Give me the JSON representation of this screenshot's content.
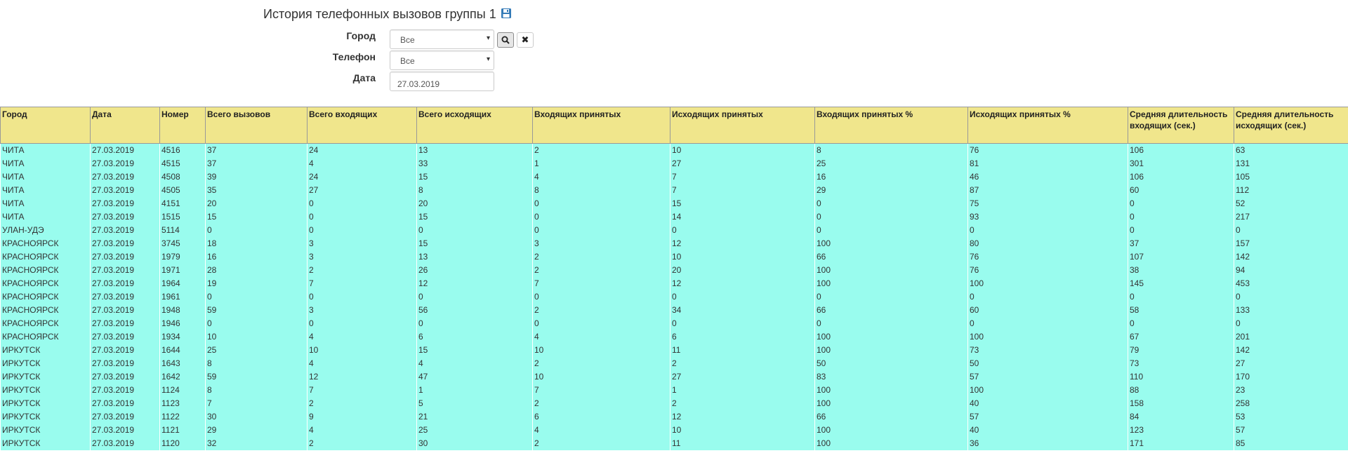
{
  "header": {
    "title": "История телефонных вызовов группы 1",
    "save_icon": "floppy-disk-icon",
    "accent_color": "#337ab7"
  },
  "filters": {
    "city_label": "Город",
    "city_value": "Все",
    "phone_label": "Телефон",
    "phone_value": "Все",
    "date_label": "Дата",
    "date_value": "27.03.2019",
    "search_icon": "search-icon",
    "clear_icon": "close-icon"
  },
  "table": {
    "header_color": "#f0e68c",
    "row_color": "#99fcee",
    "columns": [
      "Город",
      "Дата",
      "Номер",
      "Всего вызовов",
      "Всего входящих",
      "Всего исходящих",
      "Входящих принятых",
      "Исходящих принятых",
      "Входящих принятых %",
      "Исходящих принятых %",
      "Средняя длительность входящих (сек.)",
      "Средняя длительность исходящих (сек.)"
    ],
    "rows": [
      [
        "ЧИТА",
        "27.03.2019",
        "4516",
        "37",
        "24",
        "13",
        "2",
        "10",
        "8",
        "76",
        "106",
        "63"
      ],
      [
        "ЧИТА",
        "27.03.2019",
        "4515",
        "37",
        "4",
        "33",
        "1",
        "27",
        "25",
        "81",
        "301",
        "131"
      ],
      [
        "ЧИТА",
        "27.03.2019",
        "4508",
        "39",
        "24",
        "15",
        "4",
        "7",
        "16",
        "46",
        "106",
        "105"
      ],
      [
        "ЧИТА",
        "27.03.2019",
        "4505",
        "35",
        "27",
        "8",
        "8",
        "7",
        "29",
        "87",
        "60",
        "112"
      ],
      [
        "ЧИТА",
        "27.03.2019",
        "4151",
        "20",
        "0",
        "20",
        "0",
        "15",
        "0",
        "75",
        "0",
        "52"
      ],
      [
        "ЧИТА",
        "27.03.2019",
        "1515",
        "15",
        "0",
        "15",
        "0",
        "14",
        "0",
        "93",
        "0",
        "217"
      ],
      [
        "УЛАН-УДЭ",
        "27.03.2019",
        "5114",
        "0",
        "0",
        "0",
        "0",
        "0",
        "0",
        "0",
        "0",
        "0"
      ],
      [
        "КРАСНОЯРСК",
        "27.03.2019",
        "3745",
        "18",
        "3",
        "15",
        "3",
        "12",
        "100",
        "80",
        "37",
        "157"
      ],
      [
        "КРАСНОЯРСК",
        "27.03.2019",
        "1979",
        "16",
        "3",
        "13",
        "2",
        "10",
        "66",
        "76",
        "107",
        "142"
      ],
      [
        "КРАСНОЯРСК",
        "27.03.2019",
        "1971",
        "28",
        "2",
        "26",
        "2",
        "20",
        "100",
        "76",
        "38",
        "94"
      ],
      [
        "КРАСНОЯРСК",
        "27.03.2019",
        "1964",
        "19",
        "7",
        "12",
        "7",
        "12",
        "100",
        "100",
        "145",
        "453"
      ],
      [
        "КРАСНОЯРСК",
        "27.03.2019",
        "1961",
        "0",
        "0",
        "0",
        "0",
        "0",
        "0",
        "0",
        "0",
        "0"
      ],
      [
        "КРАСНОЯРСК",
        "27.03.2019",
        "1948",
        "59",
        "3",
        "56",
        "2",
        "34",
        "66",
        "60",
        "58",
        "133"
      ],
      [
        "КРАСНОЯРСК",
        "27.03.2019",
        "1946",
        "0",
        "0",
        "0",
        "0",
        "0",
        "0",
        "0",
        "0",
        "0"
      ],
      [
        "КРАСНОЯРСК",
        "27.03.2019",
        "1934",
        "10",
        "4",
        "6",
        "4",
        "6",
        "100",
        "100",
        "67",
        "201"
      ],
      [
        "ИРКУТСК",
        "27.03.2019",
        "1644",
        "25",
        "10",
        "15",
        "10",
        "11",
        "100",
        "73",
        "79",
        "142"
      ],
      [
        "ИРКУТСК",
        "27.03.2019",
        "1643",
        "8",
        "4",
        "4",
        "2",
        "2",
        "50",
        "50",
        "73",
        "27"
      ],
      [
        "ИРКУТСК",
        "27.03.2019",
        "1642",
        "59",
        "12",
        "47",
        "10",
        "27",
        "83",
        "57",
        "110",
        "170"
      ],
      [
        "ИРКУТСК",
        "27.03.2019",
        "1124",
        "8",
        "7",
        "1",
        "7",
        "1",
        "100",
        "100",
        "88",
        "23"
      ],
      [
        "ИРКУТСК",
        "27.03.2019",
        "1123",
        "7",
        "2",
        "5",
        "2",
        "2",
        "100",
        "40",
        "158",
        "258"
      ],
      [
        "ИРКУТСК",
        "27.03.2019",
        "1122",
        "30",
        "9",
        "21",
        "6",
        "12",
        "66",
        "57",
        "84",
        "53"
      ],
      [
        "ИРКУТСК",
        "27.03.2019",
        "1121",
        "29",
        "4",
        "25",
        "4",
        "10",
        "100",
        "40",
        "123",
        "57"
      ],
      [
        "ИРКУТСК",
        "27.03.2019",
        "1120",
        "32",
        "2",
        "30",
        "2",
        "11",
        "100",
        "36",
        "171",
        "85"
      ]
    ]
  }
}
